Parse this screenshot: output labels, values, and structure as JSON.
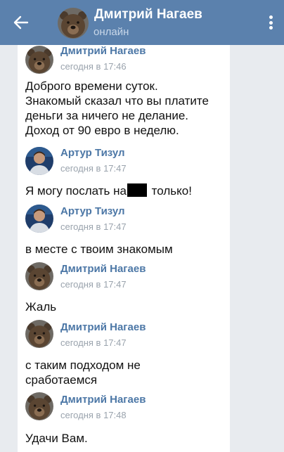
{
  "header": {
    "name": "Дмитрий Нагаев",
    "status": "онлайн",
    "back_icon": "arrow-left-icon",
    "menu_icon": "kebab-menu-icon",
    "background": "#5b81ad"
  },
  "messages": [
    {
      "author": "Дмитрий Нагаев",
      "time": "сегодня в 17:46",
      "avatar": "bear-avatar",
      "lines": [
        "Доброго времени суток.",
        "Знакомый сказал что вы платите",
        "деньги за ничего не делание.",
        "Доход от 90 евро в неделю."
      ]
    },
    {
      "author": "Артур Тизул",
      "time": "сегодня в 17:47",
      "avatar": "person-avatar",
      "text_before": "Я могу послать на",
      "text_after": " только!"
    },
    {
      "author": "Артур Тизул",
      "time": "сегодня в 17:47",
      "avatar": "person-avatar",
      "text": "в месте с твоим знакомым"
    },
    {
      "author": "Дмитрий Нагаев",
      "time": "сегодня в 17:47",
      "avatar": "bear-avatar",
      "text": "Жаль"
    },
    {
      "author": "Дмитрий Нагаев",
      "time": "сегодня в 17:47",
      "avatar": "bear-avatar",
      "lines": [
        "с таким подходом не",
        "сработаемся"
      ]
    },
    {
      "author": "Дмитрий Нагаев",
      "time": "сегодня в 17:48",
      "avatar": "bear-avatar",
      "text": "Удачи Вам."
    }
  ],
  "colors": {
    "author": "#4c77a6",
    "time": "#9aa3ad",
    "page_bg": "#e8ebef"
  }
}
